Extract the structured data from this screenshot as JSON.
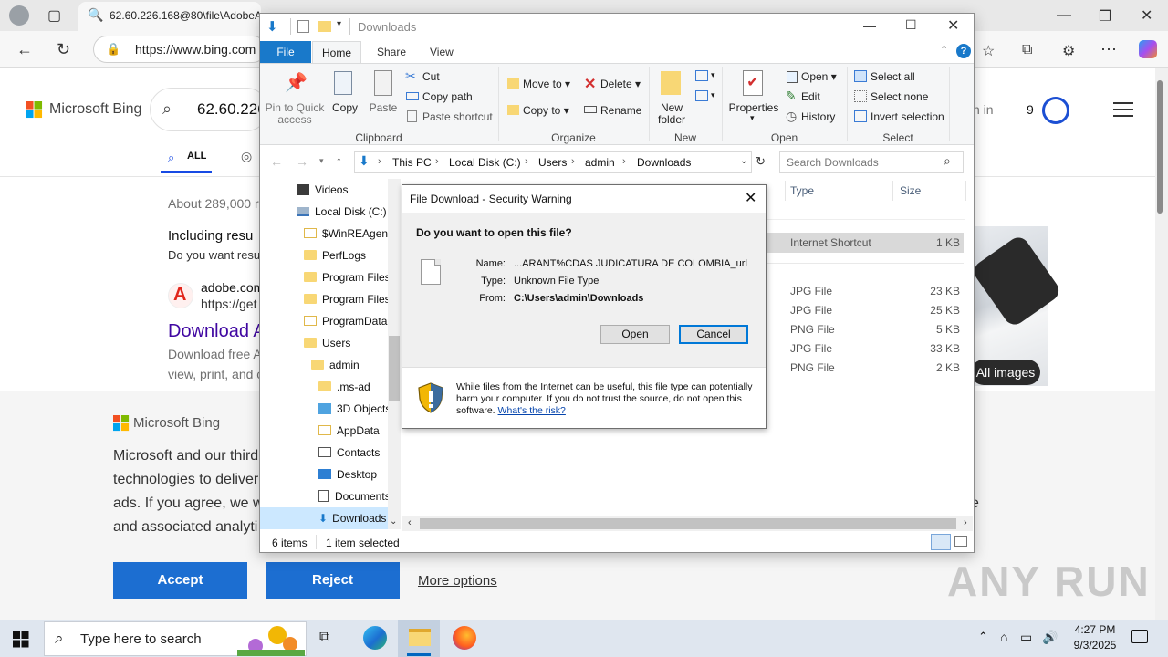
{
  "browser": {
    "tab_title": "62.60.226.168@80\\file\\AdobeA",
    "address": "https://www.bing.com",
    "window_controls": [
      "minimize",
      "restore",
      "close"
    ]
  },
  "bing": {
    "logo": "Microsoft Bing",
    "search_query": "62.60.226",
    "tabs": {
      "all": "ALL"
    },
    "results_count": "About 289,000 r",
    "including": "Including resu",
    "do_you_want": "Do you want resu",
    "result": {
      "site": "adobe.com",
      "url": "https://get",
      "title": "Download A",
      "snippet1": "Download free A",
      "snippet2": "view, print, and c"
    },
    "sign_in": "n in",
    "rewards_count": "9",
    "all_images": "All images"
  },
  "consent": {
    "logo": "Microsoft Bing",
    "lines": [
      "Microsoft and our third",
      "technologies to deliver",
      "ads. If you agree, we w",
      "and associated analyti"
    ],
    "line_tail": "e",
    "accept": "Accept",
    "reject": "Reject",
    "more_options": "More options",
    "watermark": "ANY RUN"
  },
  "explorer": {
    "title": "Downloads",
    "ribbon_tabs": [
      "File",
      "Home",
      "Share",
      "View"
    ],
    "clipboard": {
      "pin": "Pin to Quick access",
      "copy": "Copy",
      "paste": "Paste",
      "cut": "Cut",
      "copy_path": "Copy path",
      "paste_shortcut": "Paste shortcut",
      "label": "Clipboard"
    },
    "organize": {
      "move_to": "Move to",
      "copy_to": "Copy to",
      "delete": "Delete",
      "rename": "Rename",
      "label": "Organize"
    },
    "new": {
      "new_folder": "New folder",
      "label": "New"
    },
    "open": {
      "properties": "Properties",
      "open": "Open",
      "edit": "Edit",
      "history": "History",
      "label": "Open"
    },
    "select": {
      "select_all": "Select all",
      "select_none": "Select none",
      "invert": "Invert selection",
      "label": "Select"
    },
    "breadcrumb": [
      "This PC",
      "Local Disk (C:)",
      "Users",
      "admin",
      "Downloads"
    ],
    "search_placeholder": "Search Downloads",
    "tree": [
      "Videos",
      "Local Disk (C:)",
      "$WinREAgent",
      "PerfLogs",
      "Program Files",
      "Program Files",
      "ProgramData",
      "Users",
      "admin",
      ".ms-ad",
      "3D Objects",
      "AppData",
      "Contacts",
      "Desktop",
      "Documents",
      "Downloads"
    ],
    "columns": {
      "type": "Type",
      "size": "Size"
    },
    "files": [
      {
        "type": "Internet Shortcut",
        "size": "1 KB"
      },
      {
        "type": "JPG File",
        "size": "23 KB"
      },
      {
        "type": "JPG File",
        "size": "25 KB"
      },
      {
        "type": "PNG File",
        "size": "5 KB"
      },
      {
        "type": "JPG File",
        "size": "33 KB"
      },
      {
        "type": "PNG File",
        "size": "2 KB"
      }
    ],
    "status_items": "6 items",
    "status_selected": "1 item selected"
  },
  "dialog": {
    "title": "File Download - Security Warning",
    "question": "Do you want to open this file?",
    "name_label": "Name:",
    "name_value": "...ARANT%CDAS  JUDICATURA  DE COLOMBIA_url",
    "type_label": "Type:",
    "type_value": "Unknown File Type",
    "from_label": "From:",
    "from_value": "C:\\Users\\admin\\Downloads",
    "open_button": "Open",
    "cancel_button": "Cancel",
    "warning": "While files from the Internet can be useful, this file type can potentially harm your computer. If you do not trust the source, do not open this software.",
    "risk_link": "What's the risk?"
  },
  "taskbar": {
    "search_placeholder": "Type here to search",
    "time": "4:27 PM",
    "date": "9/3/2025"
  },
  "colors": {
    "accent_blue": "#1979ca",
    "bing_button": "#1c6ed1",
    "selection": "#cce8ff"
  }
}
